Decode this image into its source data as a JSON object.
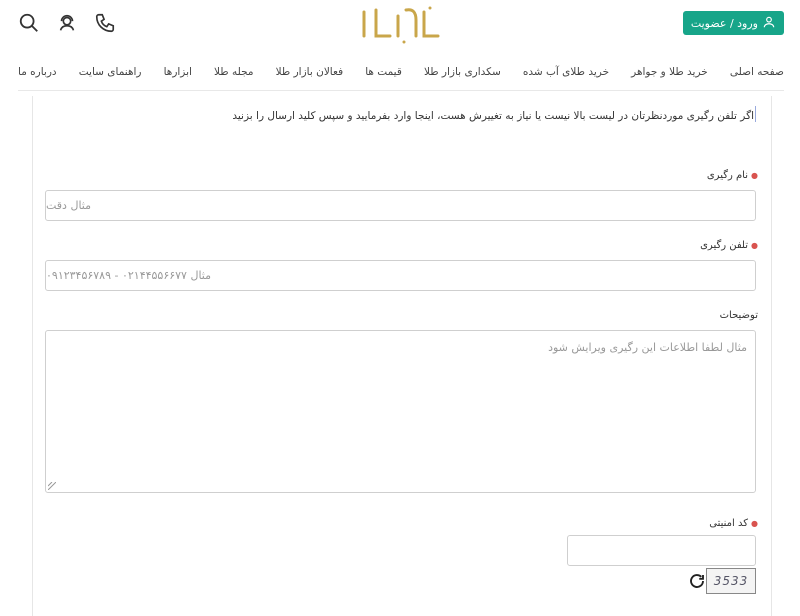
{
  "header": {
    "login_label": "ورود / عضویت",
    "logo_text": "بازار طلا"
  },
  "nav": {
    "items": [
      "صفحه اصلی",
      "خرید طلا و جواهر",
      "خرید طلای آب شده",
      "سکداری بازار طلا",
      "قیمت ها",
      "فعالان بازار طلا",
      "مجله طلا",
      "ابزارها",
      "راهنمای سایت",
      "درباره ما"
    ]
  },
  "form": {
    "intro": "اگر تلفن رگیری موردنظرتان در لیست بالا نیست یا نیاز به تغییرش هست، اینجا وارد بفرمایید و سپس کلید ارسال را بزنید",
    "name_label": "نام رگیری",
    "name_placeholder": "مثال  دقت",
    "phone_label": "تلفن رگیری",
    "phone_placeholder": "مثال  ۰۲۱۴۴۵۵۶۶۷۷ - ۰۹۱۲۳۴۵۶۷۸۹",
    "desc_label": "توضیحات",
    "desc_placeholder": "مثال  لطفا اطلاعات این رگیری ویرایش شود",
    "captcha_label": "کد امنیتی",
    "captcha_text": "3533"
  }
}
